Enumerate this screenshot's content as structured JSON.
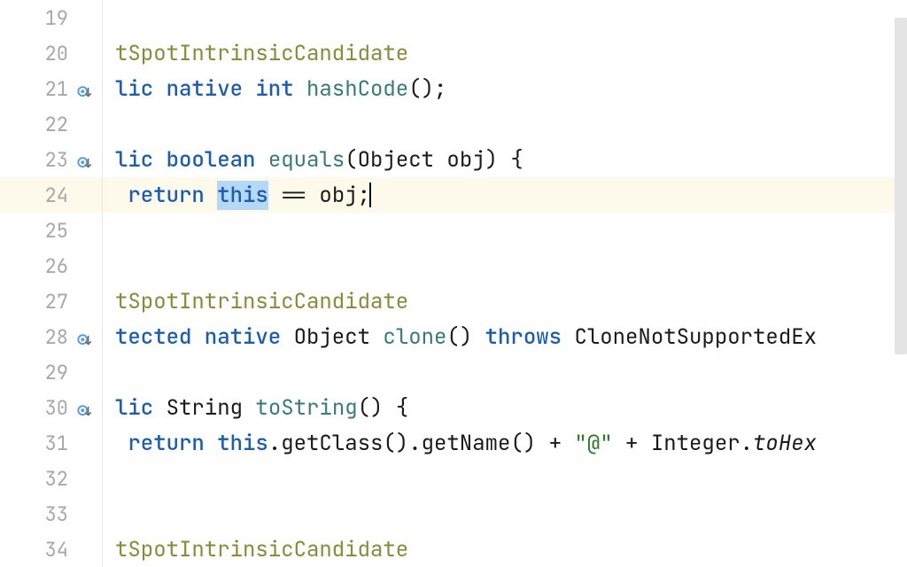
{
  "lines": [
    {
      "num": "19",
      "icon": false,
      "highlighted": false,
      "tokens": []
    },
    {
      "num": "20",
      "icon": false,
      "highlighted": false,
      "tokens": [
        {
          "cls": "tk-annotation",
          "t": "tSpotIntrinsicCandidate"
        }
      ]
    },
    {
      "num": "21",
      "icon": true,
      "highlighted": false,
      "tokens": [
        {
          "cls": "tk-keyword",
          "t": "lic native int "
        },
        {
          "cls": "tk-method",
          "t": "hashCode"
        },
        {
          "cls": "tk-text",
          "t": "();"
        }
      ]
    },
    {
      "num": "22",
      "icon": false,
      "highlighted": false,
      "tokens": []
    },
    {
      "num": "23",
      "icon": true,
      "highlighted": false,
      "tokens": [
        {
          "cls": "tk-keyword",
          "t": "lic boolean "
        },
        {
          "cls": "tk-method",
          "t": "equals"
        },
        {
          "cls": "tk-text",
          "t": "(Object obj) {"
        }
      ]
    },
    {
      "num": "24",
      "icon": false,
      "highlighted": true,
      "tokens": [
        {
          "cls": "tk-text",
          "t": " "
        },
        {
          "cls": "tk-keyword",
          "t": "return "
        },
        {
          "cls": "tk-keyword tk-selected",
          "t": "this"
        },
        {
          "cls": "tk-text",
          "t": " == obj;"
        },
        {
          "cls": "caret",
          "t": ""
        }
      ]
    },
    {
      "num": "25",
      "icon": false,
      "highlighted": false,
      "tokens": []
    },
    {
      "num": "26",
      "icon": false,
      "highlighted": false,
      "tokens": []
    },
    {
      "num": "27",
      "icon": false,
      "highlighted": false,
      "tokens": [
        {
          "cls": "tk-annotation",
          "t": "tSpotIntrinsicCandidate"
        }
      ]
    },
    {
      "num": "28",
      "icon": true,
      "highlighted": false,
      "tokens": [
        {
          "cls": "tk-keyword",
          "t": "tected native "
        },
        {
          "cls": "tk-text",
          "t": "Object "
        },
        {
          "cls": "tk-method",
          "t": "clone"
        },
        {
          "cls": "tk-text",
          "t": "() "
        },
        {
          "cls": "tk-keyword",
          "t": "throws "
        },
        {
          "cls": "tk-text",
          "t": "CloneNotSupportedEx"
        }
      ]
    },
    {
      "num": "29",
      "icon": false,
      "highlighted": false,
      "tokens": []
    },
    {
      "num": "30",
      "icon": true,
      "highlighted": false,
      "tokens": [
        {
          "cls": "tk-keyword",
          "t": "lic "
        },
        {
          "cls": "tk-text",
          "t": "String "
        },
        {
          "cls": "tk-method",
          "t": "toString"
        },
        {
          "cls": "tk-text",
          "t": "() {"
        }
      ]
    },
    {
      "num": "31",
      "icon": false,
      "highlighted": false,
      "tokens": [
        {
          "cls": "tk-text",
          "t": " "
        },
        {
          "cls": "tk-keyword",
          "t": "return this"
        },
        {
          "cls": "tk-text",
          "t": ".getClass().getName() + "
        },
        {
          "cls": "tk-string",
          "t": "\"@\""
        },
        {
          "cls": "tk-text",
          "t": " + Integer."
        },
        {
          "cls": "tk-text tk-italic",
          "t": "toHex"
        }
      ]
    },
    {
      "num": "32",
      "icon": false,
      "highlighted": false,
      "tokens": []
    },
    {
      "num": "33",
      "icon": false,
      "highlighted": false,
      "tokens": []
    },
    {
      "num": "34",
      "icon": false,
      "highlighted": false,
      "tokens": [
        {
          "cls": "tk-annotation",
          "t": "tSpotIntrinsicCandidate"
        }
      ]
    }
  ]
}
